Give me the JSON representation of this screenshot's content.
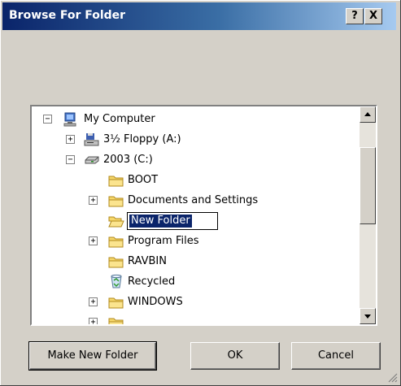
{
  "window": {
    "title": "Browse For Folder",
    "help_label": "?",
    "close_label": "X"
  },
  "tree": {
    "items": [
      {
        "label": "My Computer",
        "icon": "computer-icon",
        "expander": "minus"
      },
      {
        "label": "3½ Floppy (A:)",
        "icon": "floppy-drive-icon",
        "expander": "plus"
      },
      {
        "label": "2003 (C:)",
        "icon": "hard-drive-icon",
        "expander": "minus"
      },
      {
        "label": "BOOT",
        "icon": "folder-icon",
        "expander": "none"
      },
      {
        "label": "Documents and Settings",
        "icon": "folder-icon",
        "expander": "plus"
      },
      {
        "label": "New Folder",
        "icon": "folder-open-icon",
        "expander": "none",
        "editing": true
      },
      {
        "label": "Program Files",
        "icon": "folder-icon",
        "expander": "plus"
      },
      {
        "label": "RAVBIN",
        "icon": "folder-icon",
        "expander": "none"
      },
      {
        "label": "Recycled",
        "icon": "recycle-bin-icon",
        "expander": "none"
      },
      {
        "label": "WINDOWS",
        "icon": "folder-icon",
        "expander": "plus"
      }
    ]
  },
  "buttons": {
    "make_new_folder": "Make New Folder",
    "ok": "OK",
    "cancel": "Cancel"
  },
  "colors": {
    "face": "#d4d0c8",
    "title_start": "#0a246a",
    "title_end": "#a6caf0",
    "selection": "#0a246a",
    "folder": "#f6d76a"
  }
}
